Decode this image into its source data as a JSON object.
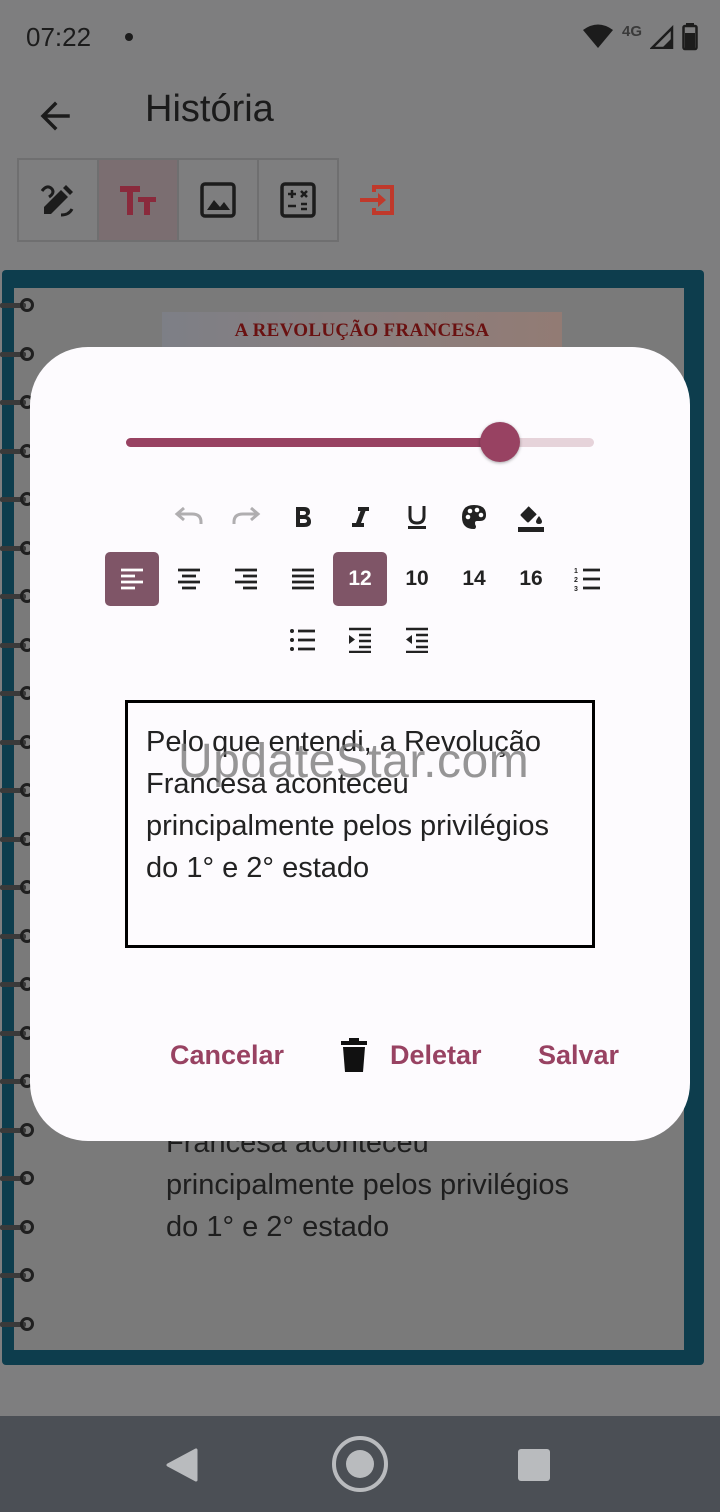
{
  "status_bar": {
    "time": "07:22",
    "network": "4G"
  },
  "app_bar": {
    "title": "História",
    "back_icon": "arrow-left-icon"
  },
  "toolbar": {
    "tools": [
      {
        "icon": "draw-pen-icon",
        "active": false
      },
      {
        "icon": "text-format-icon",
        "active": true
      },
      {
        "icon": "image-icon",
        "active": false
      },
      {
        "icon": "calculator-icon",
        "active": false
      }
    ],
    "exit_icon": "exit-icon",
    "exit_color": "#c0392b"
  },
  "page": {
    "header": "A REVOLUÇÃO FRANCESA",
    "body_line1": "Francesa aconteceu",
    "body_line2": "principalmente pelos privilégios",
    "body_line3": "do 1° e 2° estado"
  },
  "dialog": {
    "slider_value": 0.8,
    "accent_color": "#984262",
    "format_row1": [
      "undo-icon",
      "redo-icon",
      "bold-icon",
      "italic-icon",
      "underline-icon",
      "palette-icon",
      "fill-color-icon"
    ],
    "align_row": {
      "sizes": [
        "12",
        "10",
        "14",
        "16"
      ],
      "selected_align": "align-left",
      "selected_size": "12"
    },
    "text_content": "Pelo que entendi, a Revolução Francesa aconteceu principalmente pelos privilégios do 1° e 2° estado",
    "buttons": {
      "cancel": "Cancelar",
      "delete": "Deletar",
      "save": "Salvar"
    }
  },
  "watermark": "UpdateStar.com"
}
